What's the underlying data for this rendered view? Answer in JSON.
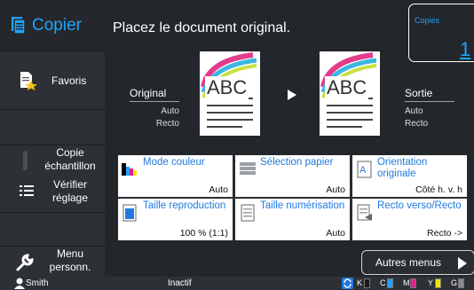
{
  "app": {
    "title": "Copier"
  },
  "sidebar": {
    "favorites": "Favoris",
    "copie_echantillon": [
      "Copie",
      "échantillon"
    ],
    "verifier_reglage": [
      "Vérifier",
      "réglage"
    ],
    "menu_perso": [
      "Menu",
      "personn."
    ]
  },
  "header": {
    "instruction": "Placez le document original.",
    "copies_label": "Copies",
    "copies_value": "1"
  },
  "document": {
    "thumb_text": "ABC",
    "original": {
      "name": "Original",
      "line1": "Auto",
      "line2": "Recto"
    },
    "sortie": {
      "name": "Sortie",
      "line1": "Auto",
      "line2": "Recto"
    }
  },
  "functions": [
    {
      "label": "Mode couleur",
      "value": "Auto",
      "icon": "color-mode-icon"
    },
    {
      "label": "Sélection papier",
      "value": "Auto",
      "icon": "paper-tray-icon"
    },
    {
      "label": "Orientation originale",
      "value": "Côté h. v. h",
      "icon": "orientation-icon"
    },
    {
      "label": "Taille reproduction",
      "value": "100 % (1:1)",
      "icon": "reproduction-size-icon"
    },
    {
      "label": "Taille numérisation",
      "value": "Auto",
      "icon": "scan-size-icon"
    },
    {
      "label": "Recto verso/Recto",
      "value": "Recto ->",
      "icon": "duplex-icon"
    }
  ],
  "more_menus": "Autres menus",
  "status": {
    "user": "Smith",
    "state": "Inactif",
    "inks": [
      "K",
      "C",
      "M",
      "Y",
      "G"
    ],
    "ink_colors": {
      "K": "#000000",
      "C": "#1fa3ff",
      "M": "#e0208f",
      "Y": "#f2e600",
      "G": "#8a8a8a"
    }
  }
}
